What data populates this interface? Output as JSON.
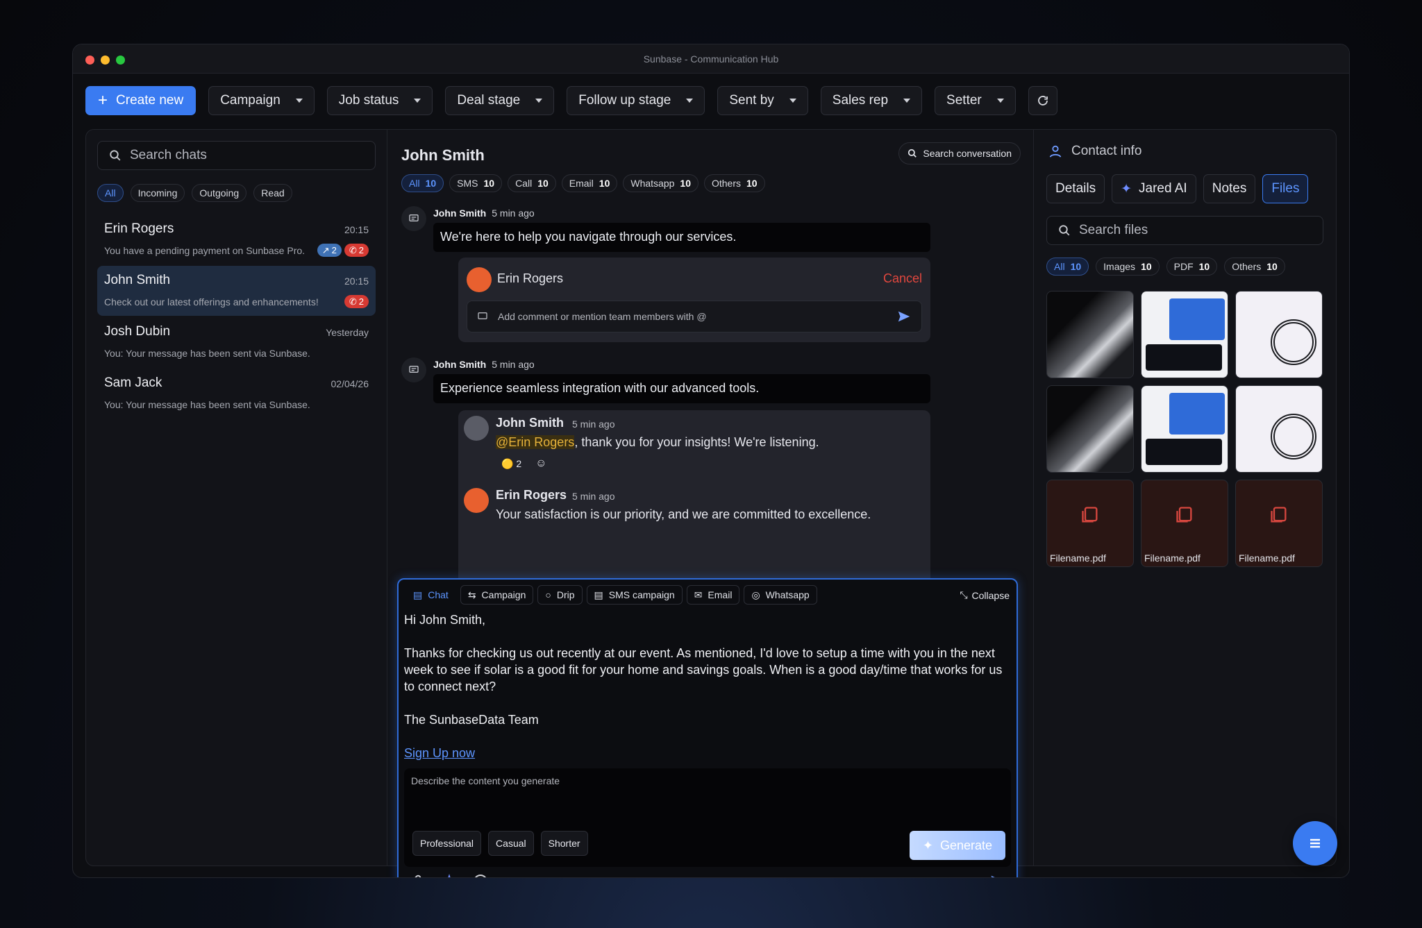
{
  "window": {
    "title": "Sunbase - Communication Hub"
  },
  "toolbar": {
    "create_label": "Create new",
    "filters": [
      "Campaign",
      "Job status",
      "Deal stage",
      "Follow up stage",
      "Sent by",
      "Sales rep",
      "Setter"
    ]
  },
  "left": {
    "search_placeholder": "Search chats",
    "filters": [
      "All",
      "Incoming",
      "Outgoing",
      "Read"
    ],
    "chats": [
      {
        "name": "Erin Rogers",
        "time": "20:15",
        "preview": "You have a pending payment on Sunbase Pro.",
        "badge_blue": "2",
        "badge_red": "2"
      },
      {
        "name": "John Smith",
        "time": "20:15",
        "preview": "Check out our latest offerings and enhancements!",
        "badge_red": "2"
      },
      {
        "name": "Josh Dubin",
        "time": "Yesterday",
        "preview": "You: Your message has been sent via Sunbase."
      },
      {
        "name": "Sam Jack",
        "time": "02/04/26",
        "preview": "You: Your message has been sent via Sunbase."
      }
    ]
  },
  "mid": {
    "contact": "John Smith",
    "search_label": "Search conversation",
    "channels": [
      {
        "label": "All",
        "count": "10"
      },
      {
        "label": "SMS",
        "count": "10"
      },
      {
        "label": "Call",
        "count": "10"
      },
      {
        "label": "Email",
        "count": "10"
      },
      {
        "label": "Whatsapp",
        "count": "10"
      },
      {
        "label": "Others",
        "count": "10"
      }
    ],
    "msg1": {
      "author": "John Smith",
      "time": "5 min ago",
      "text": "We're here to help you navigate through our services."
    },
    "reply1": {
      "author": "Erin Rogers",
      "cancel": "Cancel",
      "comment_placeholder": "Add comment or mention team members with @"
    },
    "msg2": {
      "author": "John Smith",
      "time": "5 min ago",
      "text": "Experience seamless integration with our advanced tools."
    },
    "reply2a": {
      "author": "John Smith",
      "time": "5 min ago",
      "mention": "@Erin Rogers",
      "text": ", thank you for your insights! We're listening.",
      "reaction_count": "2"
    },
    "reply2b": {
      "author": "Erin Rogers",
      "time": "5 min ago",
      "text": "Your satisfaction is our priority, and we are committed to excellence."
    }
  },
  "composer": {
    "tabs": [
      "Chat",
      "Campaign",
      "Drip",
      "SMS campaign",
      "Email",
      "Whatsapp"
    ],
    "collapse_label": "Collapse",
    "greeting": "Hi John Smith,",
    "body": "Thanks for checking us out recently at our event. As mentioned, I'd love to setup a time with you in the next week to see if solar is a good fit for your home and savings goals. When is a good day/time that works for us to connect next?",
    "signature": "The SunbaseData Team",
    "link": "Sign Up now",
    "ai_placeholder": "Describe the content you generate",
    "ai_chips": [
      "Professional",
      "Casual",
      "Shorter"
    ],
    "generate_label": "Generate"
  },
  "right": {
    "title": "Contact info",
    "tabs": [
      "Details",
      "Jared AI",
      "Notes",
      "Files"
    ],
    "search_placeholder": "Search files",
    "filters": [
      {
        "label": "All",
        "count": "10"
      },
      {
        "label": "Images",
        "count": "10"
      },
      {
        "label": "PDF",
        "count": "10"
      },
      {
        "label": "Others",
        "count": "10"
      }
    ],
    "files": [
      "Filename.pdf",
      "Filename.pdf",
      "Filename.pdf"
    ]
  },
  "colors": {
    "accent": "#3a7bf1",
    "danger": "#d73a33",
    "mention": "#e6b23a"
  }
}
